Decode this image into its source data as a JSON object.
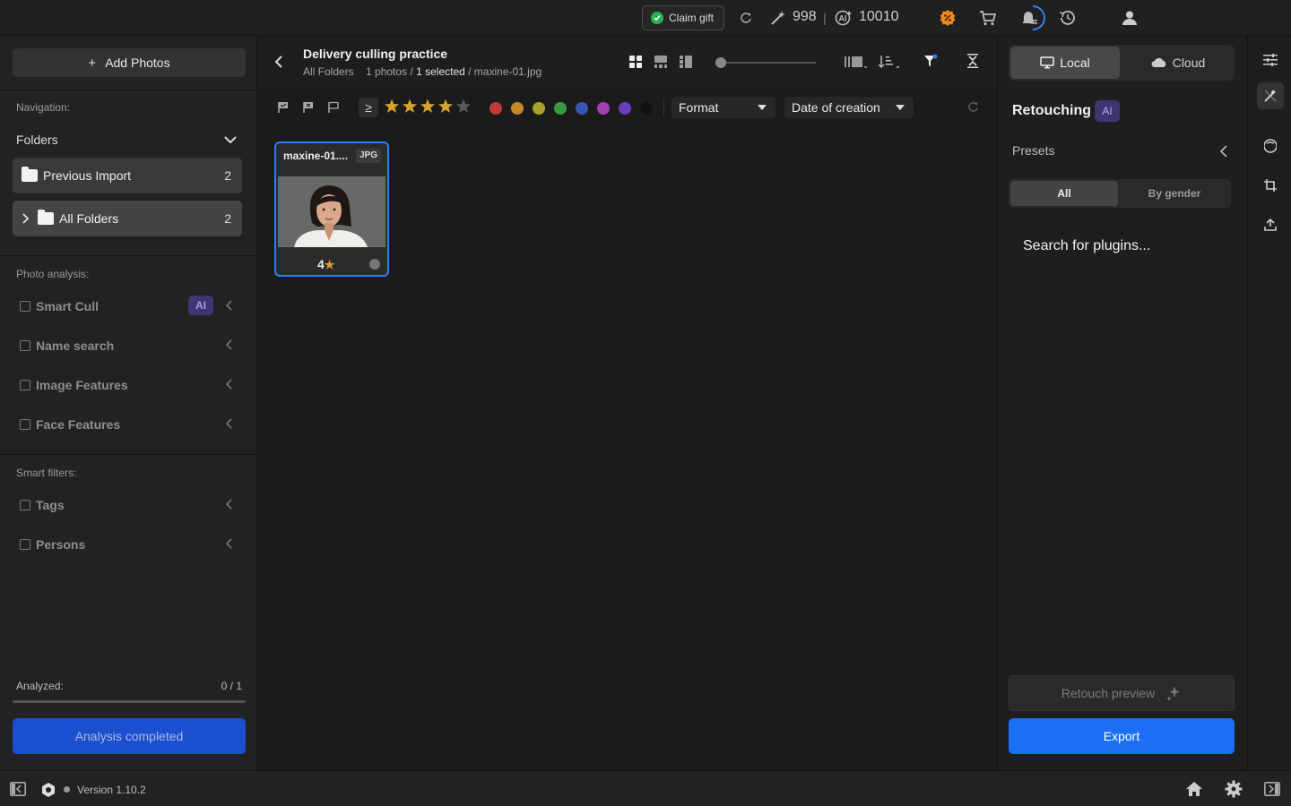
{
  "topbar": {
    "claim_gift": "Claim gift",
    "credits_magic": "998",
    "separator": "|",
    "credits_ai": "10010"
  },
  "left": {
    "add_photos": "Add Photos",
    "navigation_label": "Navigation:",
    "folders_label": "Folders",
    "folder_items": [
      {
        "label": "Previous Import",
        "count": "2"
      },
      {
        "label": "All Folders",
        "count": "2"
      }
    ],
    "photo_analysis_label": "Photo analysis:",
    "analysis_filters": [
      {
        "label": "Smart Cull",
        "badge": "AI"
      },
      {
        "label": "Name search"
      },
      {
        "label": "Image Features"
      },
      {
        "label": "Face Features"
      }
    ],
    "smart_filters_label": "Smart filters:",
    "smart_filters": [
      {
        "label": "Tags"
      },
      {
        "label": "Persons"
      }
    ],
    "analyzed_label": "Analyzed:",
    "analyzed_value": "0 / 1",
    "analyzed_fraction": 0,
    "analysis_button": "Analysis completed"
  },
  "center": {
    "title": "Delivery culling practice",
    "breadcrumb_root": "All Folders",
    "breadcrumb_count": "1 photos /",
    "breadcrumb_selected": "1 selected",
    "breadcrumb_file": "/ maxine-01.jpg",
    "rating_operator": "≥",
    "rating_stars": 4,
    "color_labels": [
      "#c13b3b",
      "#c48a2a",
      "#a9a227",
      "#3a9a3f",
      "#3b55b5",
      "#a23fb3",
      "#6a3fbd",
      "#111111"
    ],
    "format_select": "Format",
    "sort_select": "Date of creation",
    "photos": [
      {
        "name": "maxine-01....",
        "format": "JPG",
        "rating": "4"
      }
    ]
  },
  "right": {
    "tab_local": "Local",
    "tab_cloud": "Cloud",
    "retouching": "Retouching",
    "ai_badge": "AI",
    "presets": "Presets",
    "seg_all": "All",
    "seg_gender": "By gender",
    "search_plugins": "Search for plugins...",
    "retouch_preview": "Retouch preview",
    "export": "Export"
  },
  "bottom": {
    "version": "Version 1.10.2"
  },
  "colors": {
    "accent": "#1a6ff2",
    "selection": "#2f7ff0",
    "ai_badge_bg": "#3e3672"
  }
}
